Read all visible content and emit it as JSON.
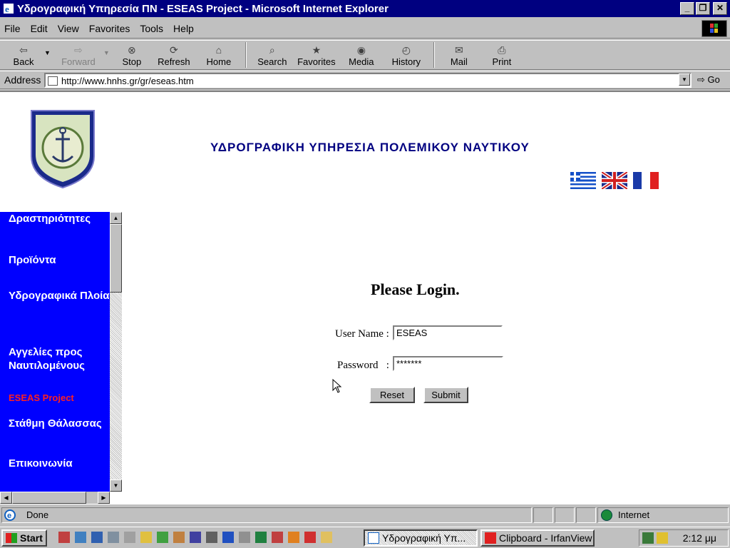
{
  "window": {
    "title": "Υδρογραφική Υπηρεσία ΠΝ - ESEAS Project - Microsoft Internet Explorer",
    "min_glyph": "_",
    "max_glyph": "❐",
    "close_glyph": "✕"
  },
  "menubar": {
    "items": [
      "File",
      "Edit",
      "View",
      "Favorites",
      "Tools",
      "Help"
    ]
  },
  "toolbar": {
    "back": "Back",
    "forward": "Forward",
    "stop": "Stop",
    "refresh": "Refresh",
    "home": "Home",
    "search": "Search",
    "favorites": "Favorites",
    "media": "Media",
    "history": "History",
    "mail": "Mail",
    "print": "Print"
  },
  "address": {
    "label": "Address",
    "url": "http://www.hnhs.gr/gr/eseas.htm",
    "go": "Go"
  },
  "page": {
    "site_title": "ΥΔΡΟΓΡΑΦΙΚΗ ΥΠΗΡΕΣΙΑ ΠΟΛΕΜΙΚΟΥ ΝΑΥΤΙΚΟΥ",
    "nav": [
      "Δραστηριότητες",
      "Προϊόντα",
      "Υδρογραφικά Πλοία",
      "Αγγελίες προς Ναυτιλομένους",
      "ESEAS Project",
      "Στάθμη Θάλασσας",
      "Επικοινωνία"
    ],
    "login": {
      "heading": "Please Login.",
      "username_label": "User Name :",
      "username_value": "ESEAS",
      "password_label": "Password   :",
      "password_value": "*******",
      "reset": "Reset",
      "submit": "Submit"
    }
  },
  "status": {
    "text": "Done",
    "zone": "Internet"
  },
  "taskbar": {
    "start": "Start",
    "tasks": [
      "Υδρογραφική Υπ...",
      "Clipboard - IrfanView"
    ],
    "clock": "2:12 μμ"
  },
  "colors": {
    "titlebar": "#000080",
    "sidebar": "#0000ff",
    "site_title": "#000080",
    "active_nav": "#ff2020"
  }
}
